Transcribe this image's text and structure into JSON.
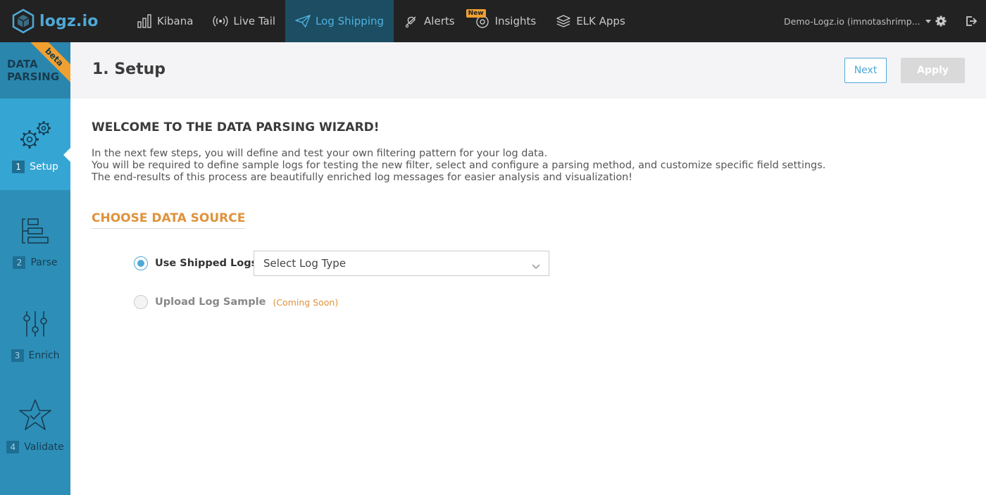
{
  "app": {
    "logo_text": "logz.io",
    "brand_color": "#4fa9d6"
  },
  "nav": {
    "items": [
      {
        "label": "Kibana",
        "icon": "bar-chart-icon"
      },
      {
        "label": "Live Tail",
        "icon": "broadcast-icon"
      },
      {
        "label": "Log Shipping",
        "icon": "paper-plane-icon",
        "active": true
      },
      {
        "label": "Alerts",
        "icon": "bell-icon"
      },
      {
        "label": "Insights",
        "icon": "eye-icon",
        "badge": "New"
      },
      {
        "label": "ELK Apps",
        "icon": "layers-icon"
      }
    ],
    "account_label": "Demo-Logz.io (imnotashrimp..."
  },
  "sidebar": {
    "title_line1": "DATA",
    "title_line2": "PARSING",
    "ribbon": "beta",
    "steps": [
      {
        "num": "1",
        "label": "Setup",
        "icon": "gears-icon",
        "active": true
      },
      {
        "num": "2",
        "label": "Parse",
        "icon": "hierarchy-icon"
      },
      {
        "num": "3",
        "label": "Enrich",
        "icon": "sliders-icon"
      },
      {
        "num": "4",
        "label": "Validate",
        "icon": "star-check-icon"
      }
    ]
  },
  "header": {
    "title": "1. Setup",
    "next_label": "Next",
    "apply_label": "Apply"
  },
  "content": {
    "welcome": "WELCOME TO THE DATA PARSING WIZARD!",
    "intro_lines": [
      "In the next few steps, you will define and test your own filtering pattern for your log data.",
      "You will be required to define sample logs for testing the new filter, select and configure a parsing method, and customize specific field settings.",
      "The end-results of this process are beautifully enriched log messages for easier analysis and visualization!"
    ],
    "choose_title": "CHOOSE DATA SOURCE",
    "option_shipped": "Use Shipped Logs",
    "select_placeholder": "Select Log Type",
    "option_upload": "Upload Log Sample",
    "coming_soon": "(Coming Soon)"
  }
}
